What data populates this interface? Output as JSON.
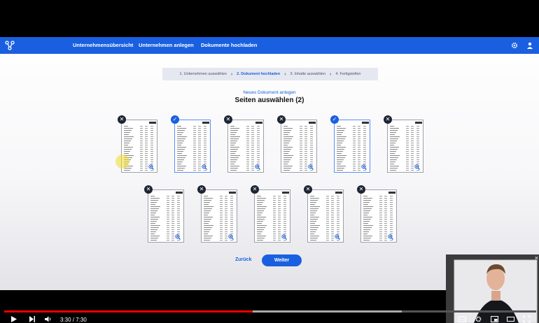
{
  "nav": {
    "links": [
      "Unternehmensübersicht",
      "Unternehmen anlegen",
      "Dokumente hochladen"
    ],
    "logo_icon": "share-nodes-icon",
    "settings_icon": "gear-icon",
    "user_icon": "user-icon",
    "color": "#1a5fe0"
  },
  "stepper": {
    "steps": [
      "1. Unternehmen auswählen",
      "2. Dokument hochladen",
      "3. Inhalte auswählen",
      "4. Fertigstellen"
    ],
    "active_step": 2
  },
  "header": {
    "subtitle": "Neues Dokument anlegen",
    "title": "Seiten auswählen (2)"
  },
  "pages": [
    {
      "badge": "remove"
    },
    {
      "badge": "selected"
    },
    {
      "badge": "remove"
    },
    {
      "badge": "remove"
    },
    {
      "badge": "selected"
    },
    {
      "badge": "remove"
    },
    {
      "badge": "remove"
    },
    {
      "badge": "remove"
    },
    {
      "badge": "remove"
    },
    {
      "badge": "remove"
    },
    {
      "badge": "remove"
    }
  ],
  "actions": {
    "back_label": "Zurück",
    "next_label": "Weiter"
  },
  "player": {
    "time": "3:30 / 7:30",
    "played_fraction": 0.467,
    "buffered_fraction": 0.747
  }
}
